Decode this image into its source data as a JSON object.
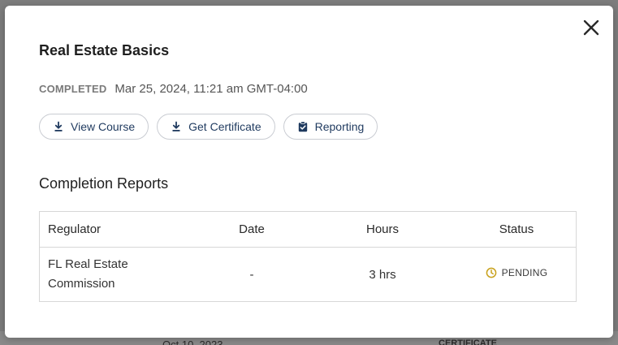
{
  "background": {
    "peek_left": "Oct 10, 2023",
    "peek_right": "CERTIFICATE"
  },
  "modal": {
    "title": "Real Estate Basics",
    "status_label": "COMPLETED",
    "completed_at": "Mar 25, 2024, 11:21 am GMT-04:00",
    "close_icon": "close-icon",
    "actions": [
      {
        "label": "View Course",
        "icon": "download-icon"
      },
      {
        "label": "Get Certificate",
        "icon": "download-icon"
      },
      {
        "label": "Reporting",
        "icon": "clipboard-check-icon"
      }
    ],
    "reports": {
      "heading": "Completion Reports",
      "columns": [
        "Regulator",
        "Date",
        "Hours",
        "Status"
      ],
      "rows": [
        {
          "regulator": "FL Real Estate Commission",
          "date": "-",
          "hours": "3 hrs",
          "status": "PENDING",
          "status_icon": "clock-icon"
        }
      ]
    }
  },
  "colors": {
    "accent": "#1f3a5f",
    "pending": "#c8a11c",
    "overlay": "#7d7d7d"
  }
}
